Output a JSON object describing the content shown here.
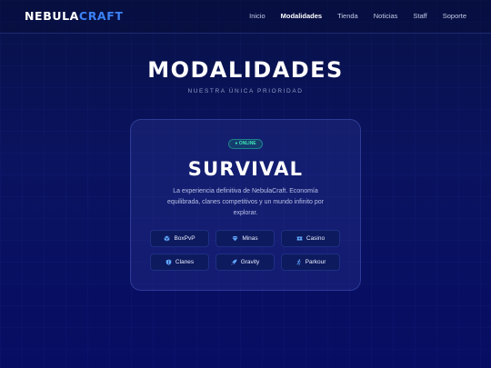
{
  "header": {
    "logo_part1": "NEBULA",
    "logo_part2": "CRAFT",
    "nav": [
      {
        "label": "Inicio"
      },
      {
        "label": "Modalidades"
      },
      {
        "label": "Tienda"
      },
      {
        "label": "Noticias"
      },
      {
        "label": "Staff"
      },
      {
        "label": "Soporte"
      }
    ],
    "active_nav": "Modalidades"
  },
  "hero": {
    "title": "MODALIDADES",
    "subtitle": "NUESTRA ÚNICA PRIORIDAD"
  },
  "mode_card": {
    "status_badge": "● ONLINE",
    "title": "SURVIVAL",
    "description": "La experiencia definitiva de NebulaCraft. Economía equilibrada, clanes competitivos y un mundo infinito por explorar.",
    "buttons": [
      {
        "label": "BoxPvP",
        "icon": "cube-icon"
      },
      {
        "label": "Minas",
        "icon": "gem-icon"
      },
      {
        "label": "Casino",
        "icon": "ticket-icon"
      },
      {
        "label": "Clanes",
        "icon": "shield-icon"
      },
      {
        "label": "Gravity",
        "icon": "rocket-icon"
      },
      {
        "label": "Parkour",
        "icon": "runner-icon"
      }
    ]
  },
  "colors": {
    "background": "#0a1360",
    "accent": "#3b82f6",
    "online": "#3ee6b6",
    "button_bg": "#0d1a5e"
  }
}
